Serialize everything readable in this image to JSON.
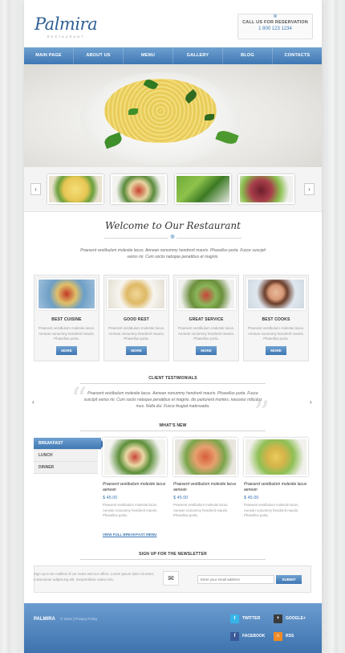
{
  "header": {
    "logo_name": "Palmira",
    "logo_sub": "RESTAURANT",
    "reservation_title": "CALL US FOR RESERVATION",
    "reservation_phone": "1 800 123 1234"
  },
  "nav": {
    "items": [
      "MAIN PAGE",
      "ABOUT US",
      "MENU",
      "GALLERY",
      "BLOG",
      "CONTACTS"
    ]
  },
  "slider": {
    "prev_icon": "chevron-left-icon",
    "next_icon": "chevron-right-icon"
  },
  "welcome": {
    "title": "Welcome to Our Restaurant",
    "text": "Praesent vestibulum molestie lacus. Aenean nonummy hendrerit mauris. Phasellus porta. Fusce suscipit varius mi. Cum sociis natoque penatibus et magnis."
  },
  "cards": [
    {
      "title": "BEST CUISINE",
      "desc": "Praesent vestibulum molestie lacus. Aenean nonummy hendrerit mauris. Phasellus porta.",
      "button": "MORE"
    },
    {
      "title": "GOOD REST",
      "desc": "Praesent vestibulum molestie lacus. Aenean nonummy hendrerit mauris. Phasellus porta.",
      "button": "MORE"
    },
    {
      "title": "GREAT SERVICE",
      "desc": "Praesent vestibulum molestie lacus. Aenean nonummy hendrerit mauris. Phasellus porta.",
      "button": "MORE"
    },
    {
      "title": "BEST COOKS",
      "desc": "Praesent vestibulum molestie lacus. Aenean nonummy hendrerit mauris. Phasellus porta.",
      "button": "MORE"
    }
  ],
  "testimonials": {
    "title": "CLIENT TESTIMONIALS",
    "text": "Praesent vestibulum molestie lacus. Aenean nonummy hendrerit mauris. Phasellus porta. Fusce suscipit varius mi. Cum sociis natoque penatibus et magnis, dis parturient montes, nascetur ridiculus mus. Nulla dui. Fusce feugiat malesuada."
  },
  "whats_new": {
    "title": "WHAT'S NEW",
    "tabs": [
      "BREAKFAST",
      "LUNCH",
      "DINNER"
    ],
    "items": [
      {
        "title": "Praesent vestibulum molestie lacus aenean",
        "price": "$ 45.00",
        "desc": "Praesent vestibulum molestie lacus. Aenean nonummy hendrerit mauris. Phasellus porta."
      },
      {
        "title": "Praesent vestibulum molestie lacus aenean",
        "price": "$ 45.00",
        "desc": "Praesent vestibulum molestie lacus. Aenean nonummy hendrerit mauris. Phasellus porta."
      },
      {
        "title": "Praesent vestibulum molestie lacus aenean",
        "price": "$ 45.00",
        "desc": "Praesent vestibulum molestie lacus. Aenean nonummy hendrerit mauris. Phasellus porta."
      }
    ],
    "view_link": "VIEW FULL BREAKFAST MENU"
  },
  "newsletter": {
    "title": "SIGN UP FOR THE NEWSLETTER",
    "text": "Sign up to be notified of our news and our offers. Lorem ipsum dolor sit amet, consectetur adipiscing elit. Suspendisse varius nisi.",
    "placeholder": "Enter your email address",
    "button": "SUBMIT",
    "icon": "envelope-icon"
  },
  "footer": {
    "brand": "PALMIRA",
    "copyright": "© 2013 | Privacy Policy",
    "social": [
      "TWITTER",
      "GOOGLE+",
      "FACEBOOK",
      "RSS"
    ]
  }
}
